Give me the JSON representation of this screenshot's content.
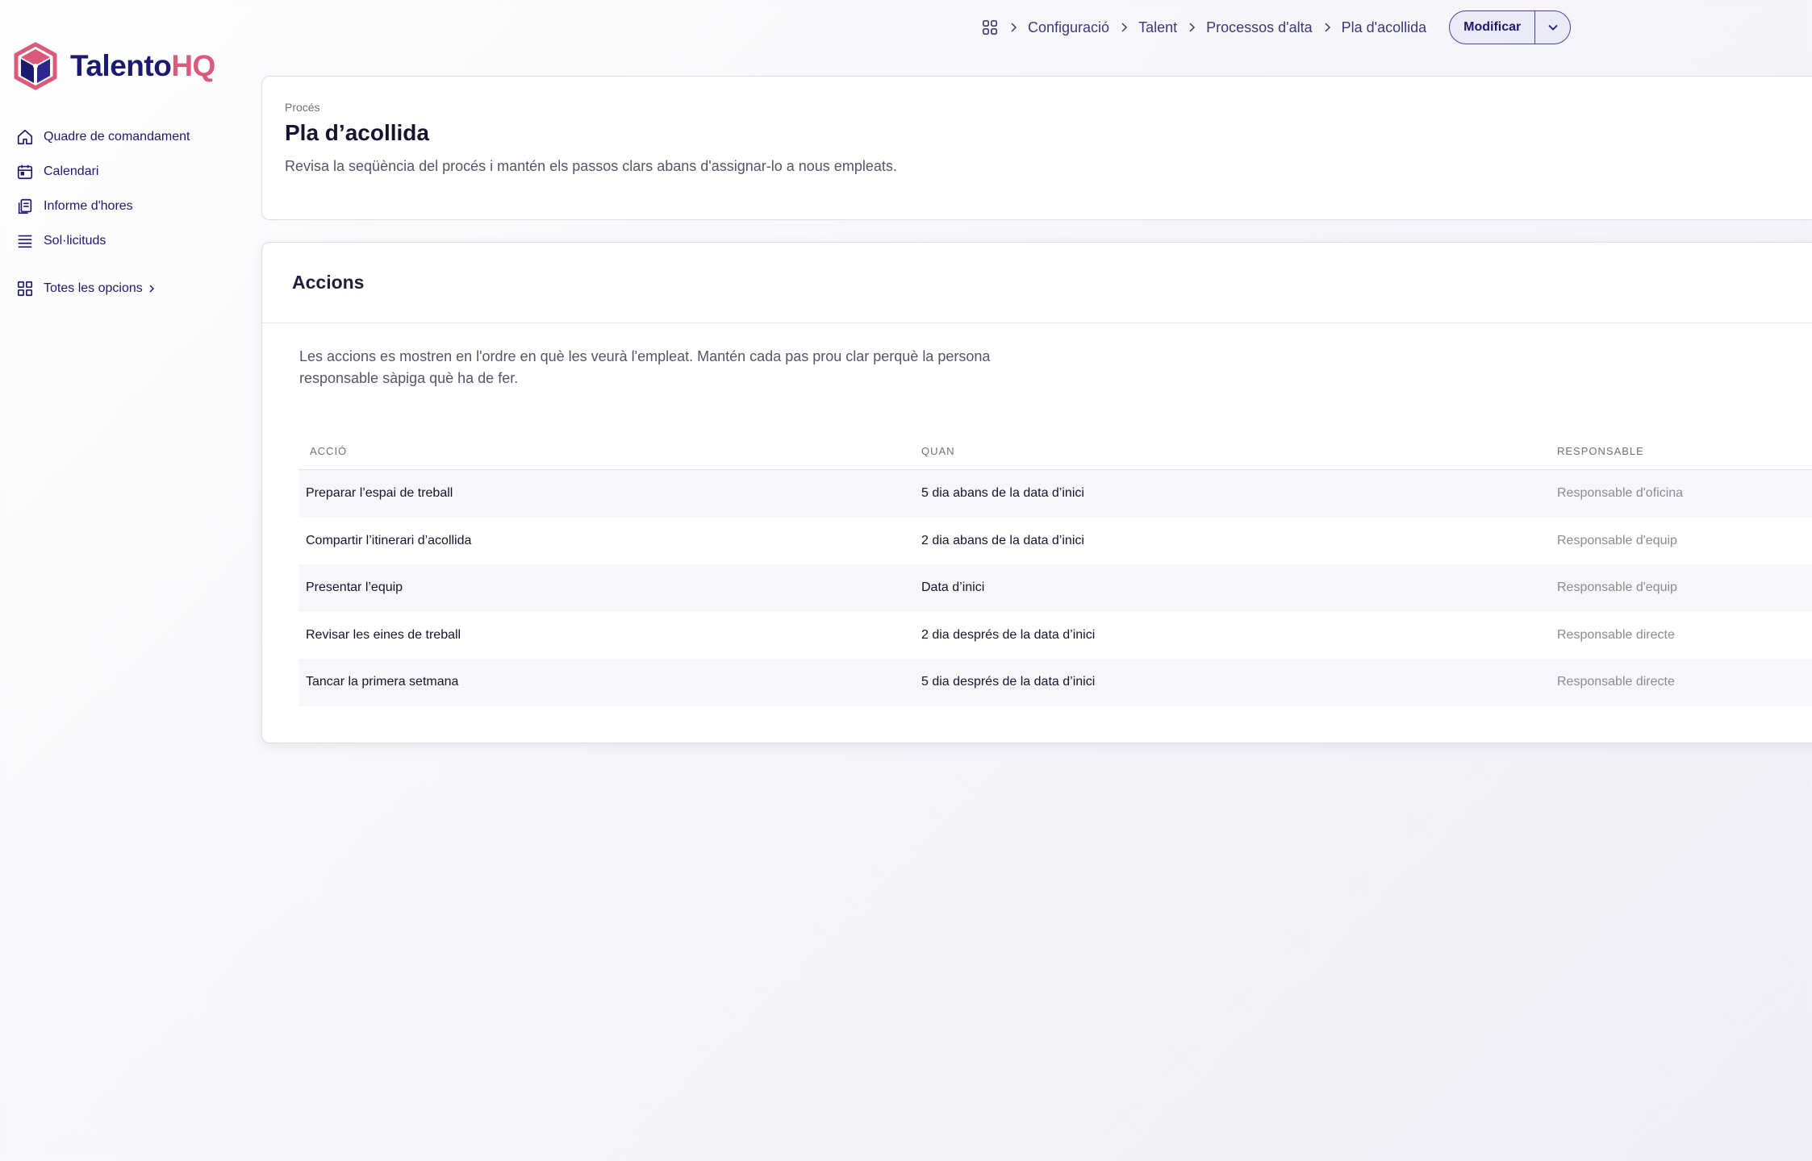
{
  "brand": {
    "name_main": "Talento",
    "name_accent": "HQ",
    "primary_color": "#1c1a6e",
    "accent_color": "#d95a7a"
  },
  "sidebar": {
    "items": [
      {
        "label": "Quadre de comandament",
        "icon": "home-icon"
      },
      {
        "label": "Calendari",
        "icon": "calendar-icon"
      },
      {
        "label": "Informe d'hores",
        "icon": "report-icon"
      },
      {
        "label": "Sol·licituds",
        "icon": "list-icon"
      }
    ],
    "all_options": {
      "label": "Totes les opcions",
      "icon": "grid-icon"
    }
  },
  "breadcrumb": {
    "items": [
      "Configuració",
      "Talent",
      "Processos d'alta",
      "Pla d'acollida"
    ]
  },
  "toolbar": {
    "edit_label": "Modificar"
  },
  "process": {
    "eyebrow": "Procés",
    "title": "Pla d’acollida",
    "description": "Revisa la seqüència del procés i mantén els passos clars abans d'assignar-lo a nous empleats."
  },
  "actions": {
    "title": "Accions",
    "description": "Les accions es mostren en l'ordre en què les veurà l'empleat. Mantén cada pas prou clar perquè la persona responsable sàpiga què ha de fer.",
    "columns": [
      "ACCIÓ",
      "QUAN",
      "RESPONSABLE"
    ],
    "rows": [
      {
        "action": "Preparar l’espai de treball",
        "when": "5 dia abans de la data d’inici",
        "owner": "Responsable d'oficina"
      },
      {
        "action": "Compartir l’itinerari d’acollida",
        "when": "2 dia abans de la data d’inici",
        "owner": "Responsable d'equip"
      },
      {
        "action": "Presentar l’equip",
        "when": "Data d’inici",
        "owner": "Responsable d'equip"
      },
      {
        "action": "Revisar les eines de treball",
        "when": "2 dia després de la data d’inici",
        "owner": "Responsable directe"
      },
      {
        "action": "Tancar la primera setmana",
        "when": "5 dia després de la data d’inici",
        "owner": "Responsable directe"
      }
    ]
  }
}
